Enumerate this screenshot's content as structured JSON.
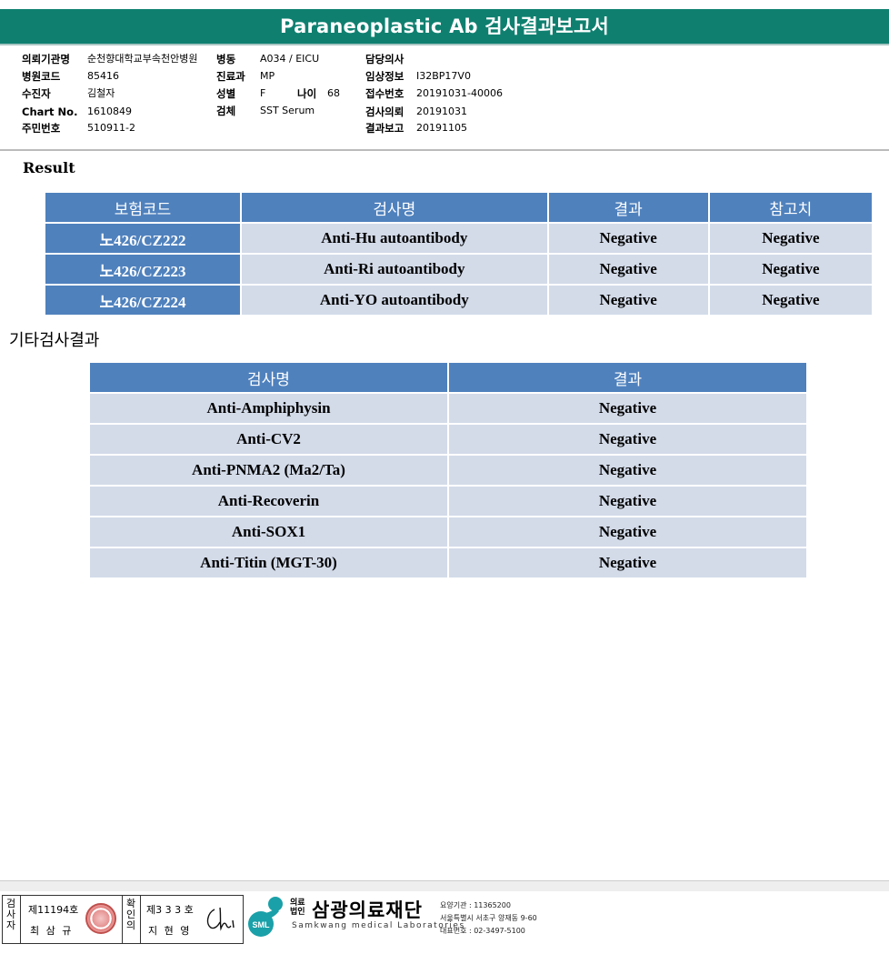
{
  "title": "Paraneoplastic Ab 검사결과보고서",
  "info": {
    "col1": [
      {
        "label": "의뢰기관명",
        "value": "순천향대학교부속천안병원"
      },
      {
        "label": "병원코드",
        "value": "85416"
      },
      {
        "label": "수진자",
        "value": "김철자"
      },
      {
        "label": "Chart No.",
        "value": "1610849"
      },
      {
        "label": "주민번호",
        "value": "510911-2"
      }
    ],
    "col2": [
      {
        "label": "병동",
        "value": "A034 / EICU"
      },
      {
        "label": "진료과",
        "value": "MP"
      },
      {
        "label": "성별",
        "value": "F"
      },
      {
        "label": "검체",
        "value": "SST Serum"
      }
    ],
    "age": {
      "label": "나이",
      "value": "68"
    },
    "col3": [
      {
        "label": "담당의사",
        "value": ""
      },
      {
        "label": "임상정보",
        "value": "I32BP17V0"
      },
      {
        "label": "접수번호",
        "value": "20191031-40006"
      },
      {
        "label": "검사의뢰",
        "value": "20191031"
      },
      {
        "label": "결과보고",
        "value": "20191105"
      }
    ]
  },
  "result": {
    "heading": "Result",
    "headers": [
      "보험코드",
      "검사명",
      "결과",
      "참고치"
    ],
    "rows": [
      {
        "code": "노426/CZ222",
        "test": "Anti-Hu autoantibody",
        "result": "Negative",
        "reference": "Negative"
      },
      {
        "code": "노426/CZ223",
        "test": "Anti-Ri autoantibody",
        "result": "Negative",
        "reference": "Negative"
      },
      {
        "code": "노426/CZ224",
        "test": "Anti-YO autoantibody",
        "result": "Negative",
        "reference": "Negative"
      }
    ]
  },
  "other": {
    "heading": "기타검사결과",
    "headers": [
      "검사명",
      "결과"
    ],
    "rows": [
      {
        "test": "Anti-Amphiphysin",
        "result": "Negative"
      },
      {
        "test": "Anti-CV2",
        "result": "Negative"
      },
      {
        "test": "Anti-PNMA2 (Ma2/Ta)",
        "result": "Negative"
      },
      {
        "test": "Anti-Recoverin",
        "result": "Negative"
      },
      {
        "test": "Anti-SOX1",
        "result": "Negative"
      },
      {
        "test": "Anti-Titin (MGT-30)",
        "result": "Negative"
      }
    ]
  },
  "footer": {
    "examiner_label": "검사자",
    "examiner_no": "제11194호",
    "examiner_name": "최 삼 규",
    "confirmer_label": "확인의",
    "confirmer_no": "제3 3 3 호",
    "confirmer_name": "지 현 영",
    "org_type": "의료법인",
    "org_name": "삼광의료재단",
    "org_eng": "Samkwang medical Laboratories",
    "logo_text": "SML",
    "org_code": "요양기관 : 11365200",
    "org_address": "서울특별시 서초구 양재동 9-60",
    "org_phone": "대표번호 : 02-3497-5100"
  },
  "colors": {
    "title_bar": "#0f8070",
    "header_blue": "#4f81bd",
    "cell_light": "#d3dbe9",
    "logo_teal": "#1aa0a8"
  }
}
